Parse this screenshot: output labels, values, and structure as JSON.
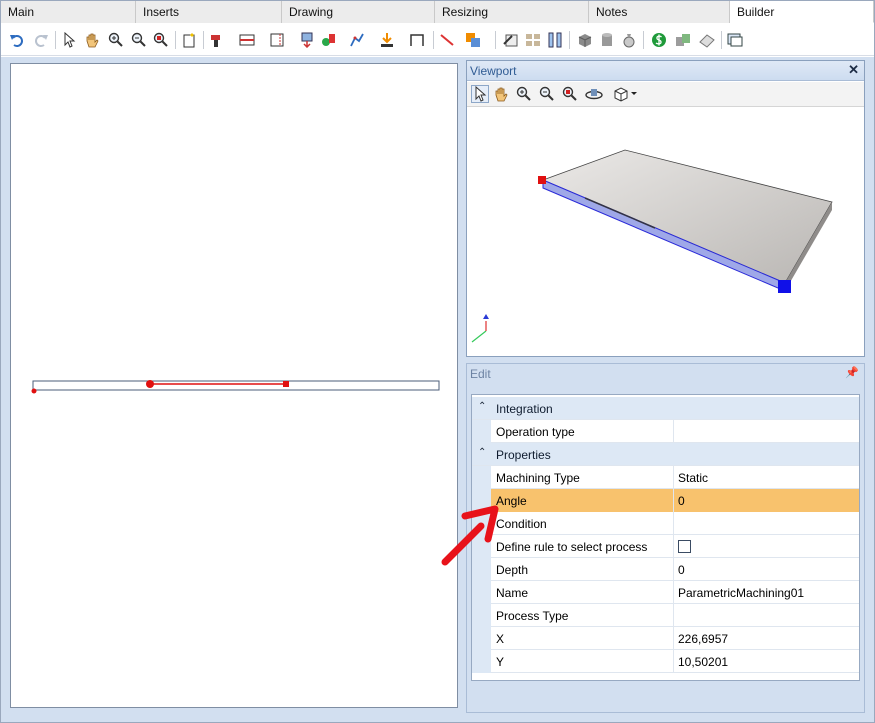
{
  "tabs": [
    {
      "label": "Main",
      "active": false
    },
    {
      "label": "Inserts",
      "active": false
    },
    {
      "label": "Drawing",
      "active": false
    },
    {
      "label": "Resizing",
      "active": false
    },
    {
      "label": "Notes",
      "active": false
    },
    {
      "label": "Builder",
      "active": true
    }
  ],
  "toolbar_icons": [
    "undo-icon",
    "redo-icon",
    "select-icon",
    "pan-icon",
    "zoom-in-icon",
    "zoom-out-icon",
    "zoom-extents-icon",
    "new-item-icon",
    "drill-icon",
    "panel-icon",
    "frame-icon",
    "insert-icon",
    "tool-icon",
    "path-icon",
    "place-icon",
    "dimension-icon",
    "line-icon",
    "copy-icon",
    "edit-icon",
    "grid-icon",
    "columns-icon",
    "box-icon",
    "cylinder-icon",
    "money-bag-icon",
    "dollar-icon",
    "parts-icon",
    "eraser-icon",
    "window-icon"
  ],
  "viewport": {
    "title": "Viewport",
    "close_label": "✕",
    "tool_icons": [
      "select-icon",
      "pan-icon",
      "zoom-in-icon",
      "zoom-out-icon",
      "zoom-extents-icon",
      "orbit-icon",
      "view-cube-icon"
    ]
  },
  "edit": {
    "title": "Edit",
    "pin_label": "📌",
    "categories": {
      "integration": {
        "label": "Integration",
        "expander": "⌃"
      },
      "properties": {
        "label": "Properties",
        "expander": "⌃"
      }
    },
    "rows": {
      "operation_type": {
        "name": "Operation type",
        "value": ""
      },
      "machining_type": {
        "name": "Machining Type",
        "value": "Static"
      },
      "angle": {
        "name": "Angle",
        "value": "0"
      },
      "condition": {
        "name": "Condition",
        "value": ""
      },
      "define_rule": {
        "name": "Define rule to select process",
        "checked": false
      },
      "depth": {
        "name": "Depth",
        "value": "0"
      },
      "name": {
        "name": "Name",
        "value": "ParametricMachining01"
      },
      "process_type": {
        "name": "Process Type",
        "value": ""
      },
      "x": {
        "name": "X",
        "value": "226,6957"
      },
      "y": {
        "name": "Y",
        "value": "10,50201"
      }
    }
  },
  "colors": {
    "accent_selection": "#f8c26d",
    "panel_background": "#d2dff0",
    "annotation_arrow": "#e8121a",
    "machining_line": "#e01010"
  }
}
